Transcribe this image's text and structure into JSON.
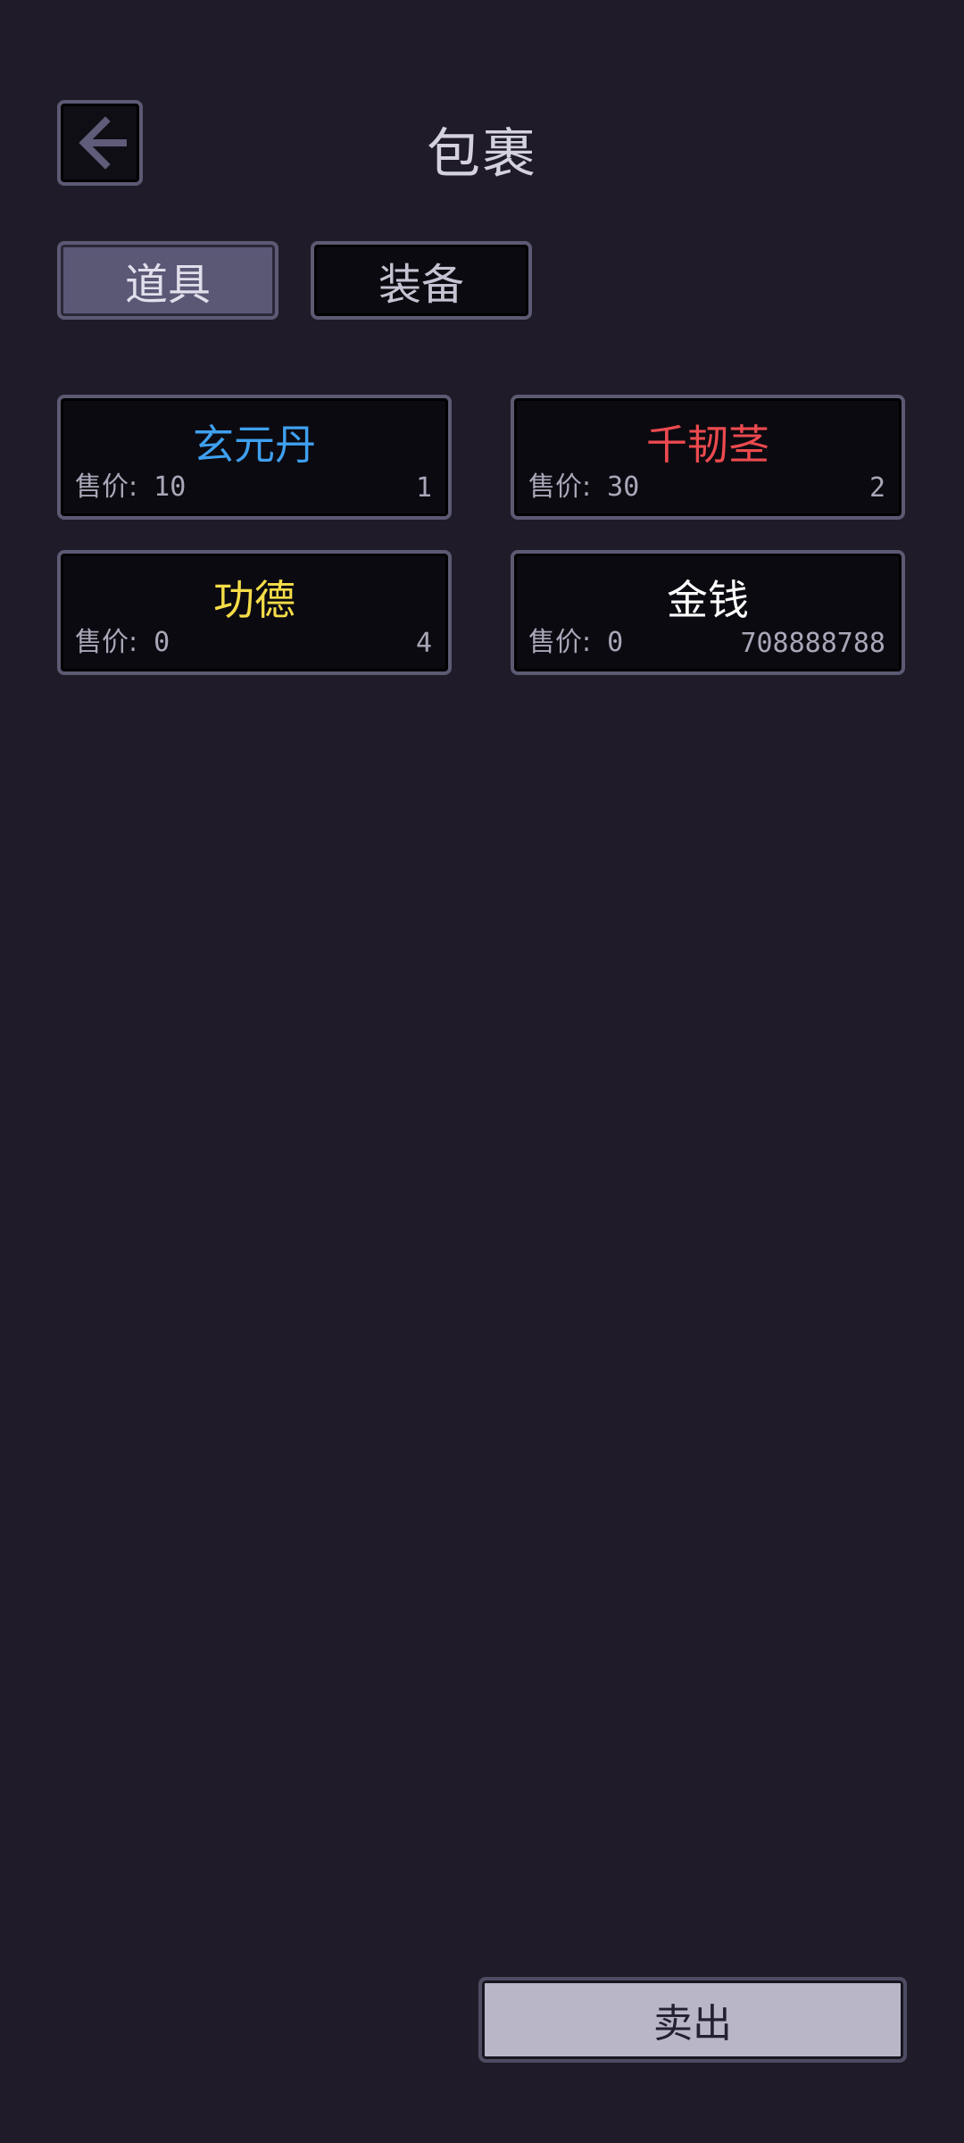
{
  "header": {
    "title": "包裹",
    "back_icon": "arrow-left-icon"
  },
  "tabs": [
    {
      "label": "道具",
      "active": true
    },
    {
      "label": "装备",
      "active": false
    }
  ],
  "items": [
    {
      "name": "玄元丹",
      "color": "#3fa0f0",
      "price_label": "售价:",
      "price": "10",
      "count": "1"
    },
    {
      "name": "千韧茎",
      "color": "#ec4a4f",
      "price_label": "售价:",
      "price": "30",
      "count": "2"
    },
    {
      "name": "功德",
      "color": "#f5dd48",
      "price_label": "售价:",
      "price": "0",
      "count": "4"
    },
    {
      "name": "金钱",
      "color": "#ffffff",
      "price_label": "售价:",
      "price": "0",
      "count": "708888788"
    }
  ],
  "actions": {
    "sell_label": "卖出"
  },
  "colors": {
    "background": "#201b29",
    "border": "#5c5a73",
    "active_tab": "#5a5875",
    "sell_button": "#b8b6c7"
  }
}
